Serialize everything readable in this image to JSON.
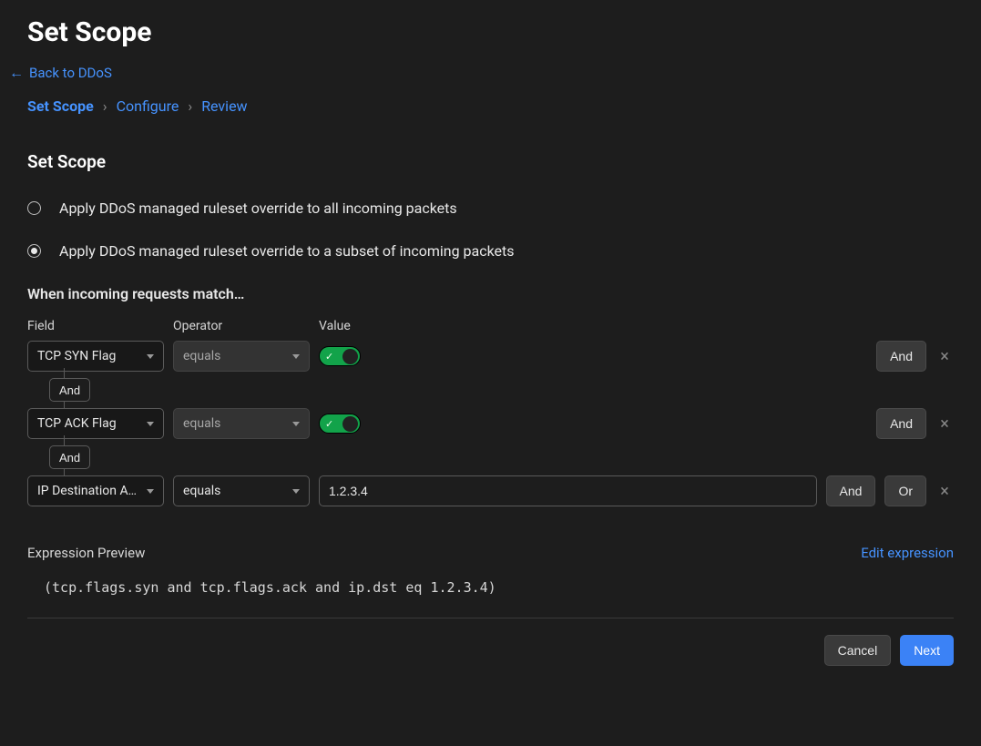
{
  "page_title": "Set Scope",
  "back_link": "Back to DDoS",
  "breadcrumb": {
    "items": [
      "Set Scope",
      "Configure",
      "Review"
    ],
    "active_index": 0
  },
  "section_title": "Set Scope",
  "radios": {
    "all": "Apply DDoS managed ruleset override to all incoming packets",
    "subset": "Apply DDoS managed ruleset override to a subset of incoming packets",
    "selected": "subset"
  },
  "match_heading": "When incoming requests match…",
  "headers": {
    "field": "Field",
    "operator": "Operator",
    "value": "Value"
  },
  "rows": [
    {
      "field": "TCP SYN Flag",
      "operator": "equals",
      "operator_disabled": true,
      "value_type": "toggle",
      "toggle_on": true,
      "trailing": [
        "And"
      ]
    },
    {
      "field": "TCP ACK Flag",
      "operator": "equals",
      "operator_disabled": true,
      "value_type": "toggle",
      "toggle_on": true,
      "trailing": [
        "And"
      ]
    },
    {
      "field": "IP Destination A…",
      "operator": "equals",
      "operator_disabled": false,
      "value_type": "text",
      "value": "1.2.3.4",
      "trailing": [
        "And",
        "Or"
      ]
    }
  ],
  "connector_label": "And",
  "preview": {
    "label": "Expression Preview",
    "edit": "Edit expression",
    "expression": "(tcp.flags.syn and tcp.flags.ack and ip.dst eq 1.2.3.4)"
  },
  "footer": {
    "cancel": "Cancel",
    "next": "Next"
  }
}
